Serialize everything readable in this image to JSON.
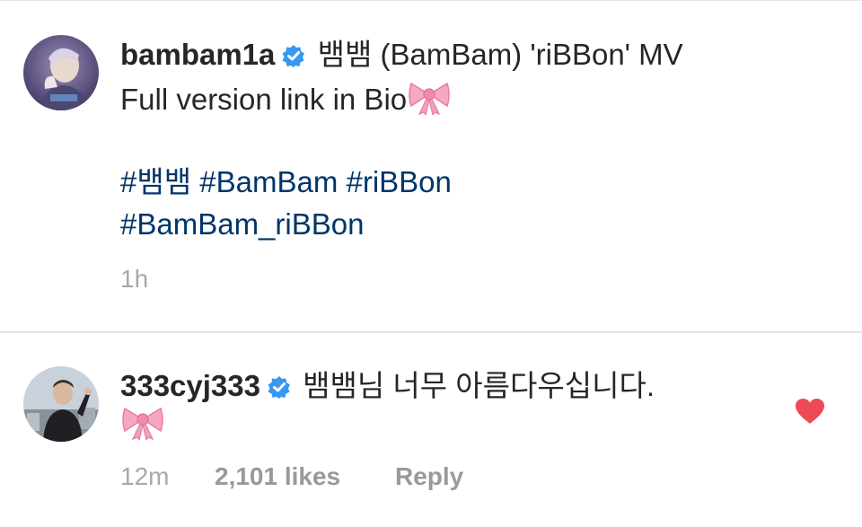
{
  "post": {
    "username": "bambam1a",
    "caption_line1": "뱀뱀 (BamBam) 'riBBon' MV",
    "caption_line2": "Full version link in Bio",
    "hashtags_line1": [
      "#뱀뱀",
      "#BamBam",
      "#riBBon"
    ],
    "hashtags_line2": [
      "#BamBam_riBBon"
    ],
    "time": "1h"
  },
  "comment": {
    "username": "333cyj333",
    "text": "뱀뱀님 너무 아름다우십니다.",
    "time": "12m",
    "likes": "2,101 likes",
    "reply_label": "Reply"
  },
  "icons": {
    "verified": "verified-badge-icon",
    "ribbon": "ribbon-emoji-icon",
    "like": "heart-icon"
  },
  "colors": {
    "verified_blue": "#3897f0",
    "hashtag_blue": "#003569",
    "heart_red": "#ed4956",
    "ribbon_pink": "#f7a7c1"
  }
}
